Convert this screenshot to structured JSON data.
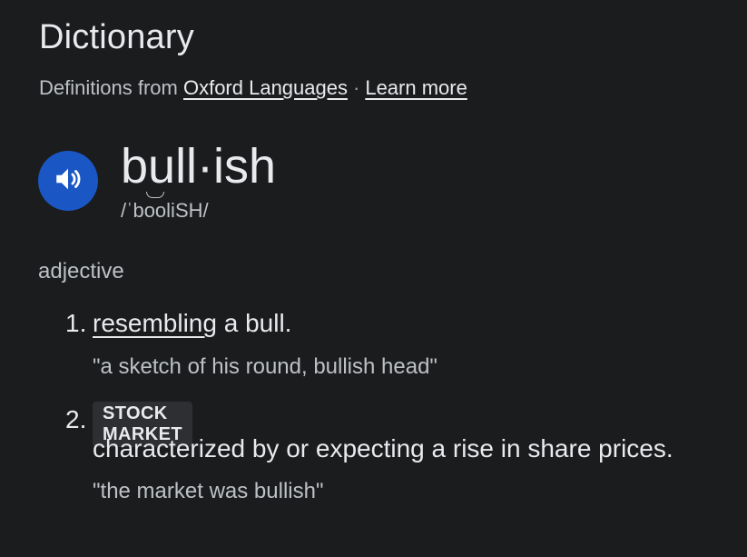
{
  "header": {
    "title": "Dictionary",
    "source_prefix": "Definitions from",
    "source_link": "Oxford Languages",
    "separator": "·",
    "learn_more": "Learn more"
  },
  "entry": {
    "word": "bull·ish",
    "phonetic_prefix": "/ˈb",
    "phonetic_tie": "oo",
    "phonetic_suffix": "liSH/",
    "audio_icon": "speaker-icon",
    "part_of_speech": "adjective"
  },
  "senses": [
    {
      "number": "1.",
      "definition_link": "resembling",
      "definition_rest": " a bull.",
      "example": "\"a sketch of his round, bullish head\""
    },
    {
      "number": "2.",
      "label": "STOCK MARKET",
      "definition": "characterized by or expecting a rise in share prices.",
      "example": "\"the market was bullish\""
    }
  ],
  "colors": {
    "background": "#1b1c1e",
    "accent": "#1a56c4",
    "text": "#e8eaed",
    "muted": "#bdc1c6"
  }
}
